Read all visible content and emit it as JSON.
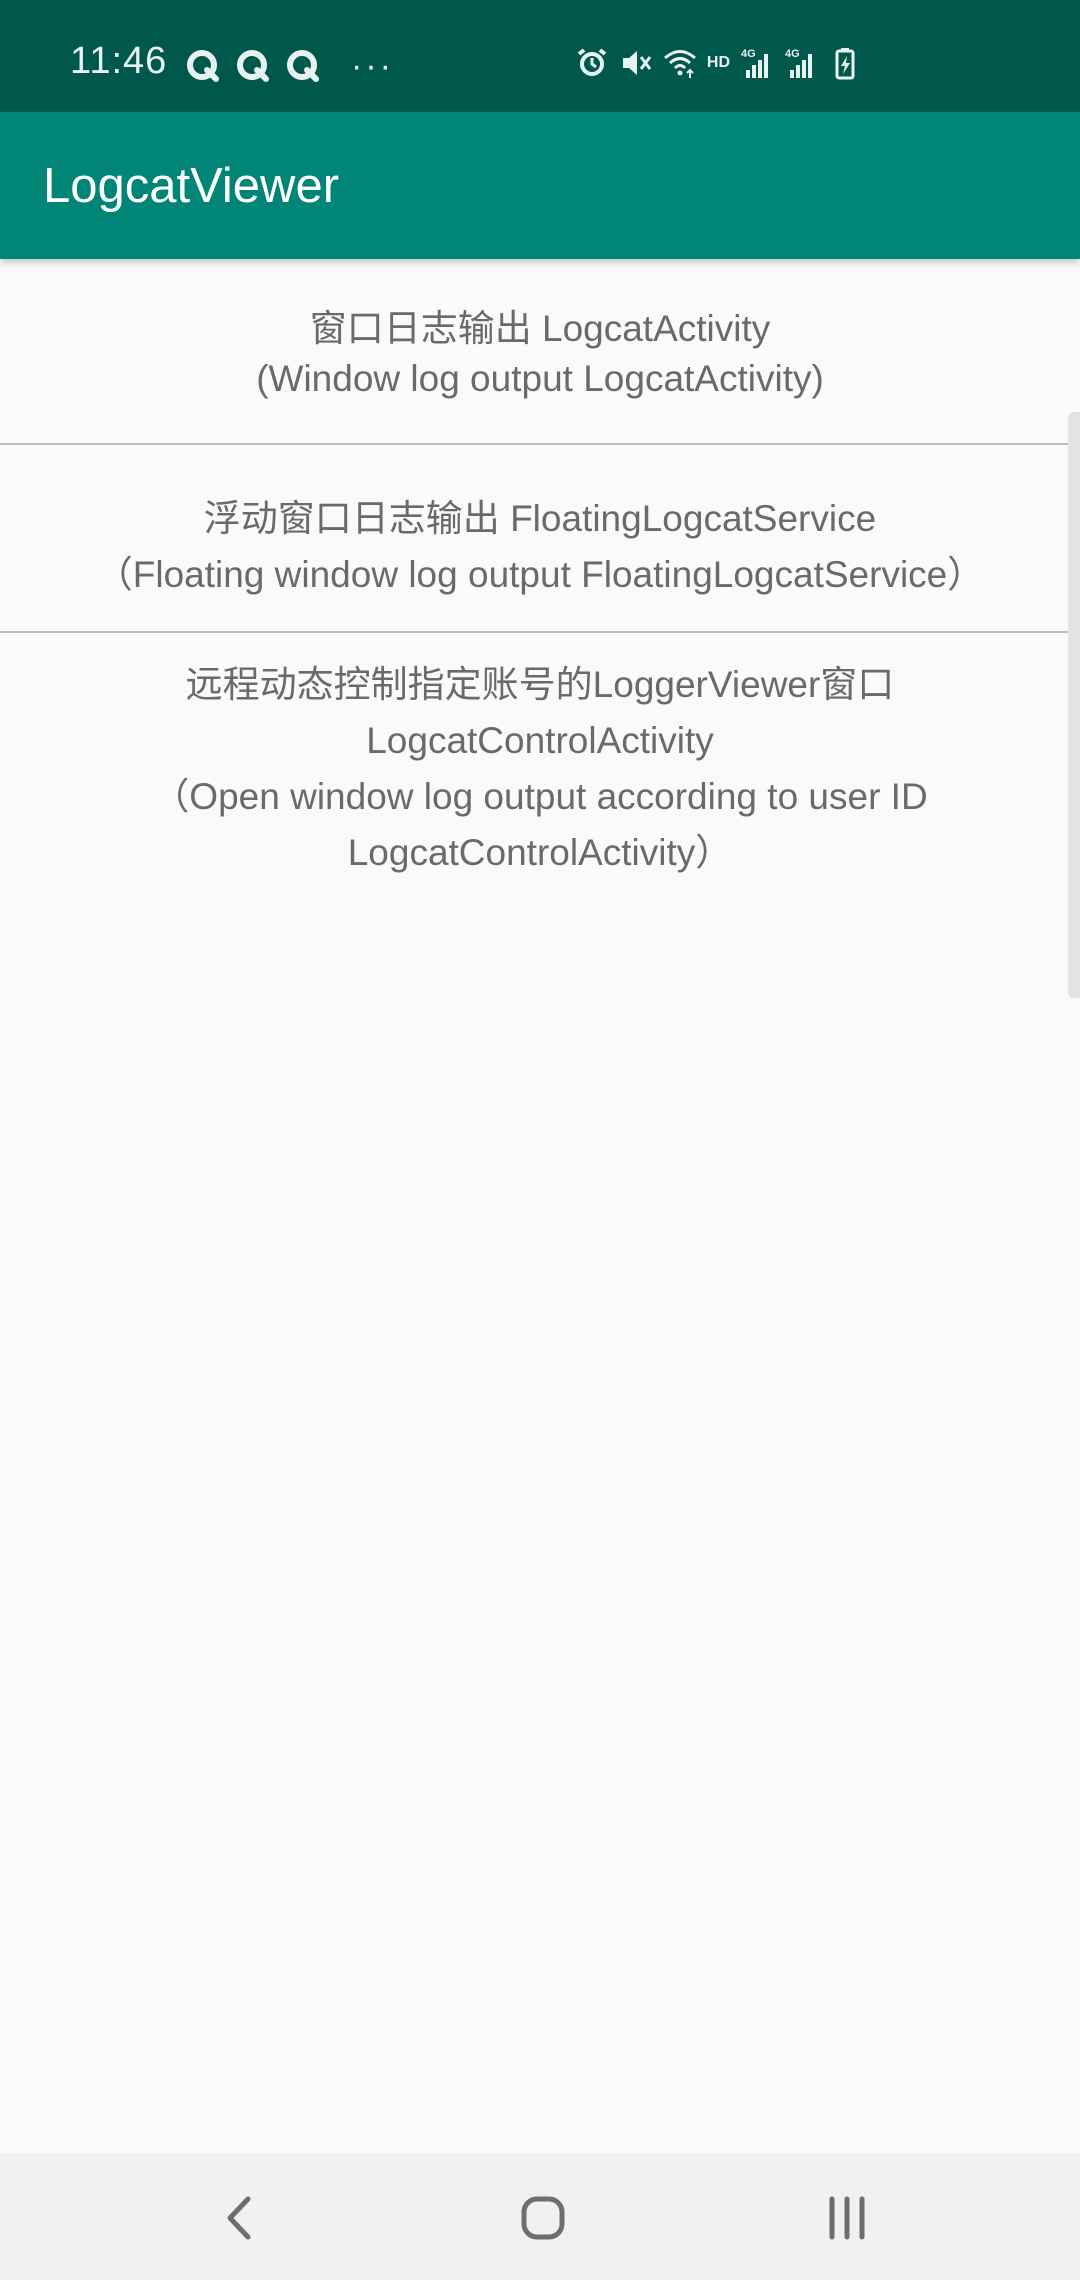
{
  "status_bar": {
    "time": "11:46",
    "left_icons": [
      "q-notification-icon",
      "q-notification-icon",
      "q-notification-icon"
    ],
    "overflow": "···",
    "right_icons": [
      "alarm-icon",
      "mute-icon",
      "wifi-icon",
      "hd-label",
      "signal-4g-icon",
      "signal-4g-icon",
      "battery-charging-icon"
    ],
    "hd_label": "HD"
  },
  "app_bar": {
    "title": "LogcatViewer"
  },
  "list": {
    "items": [
      {
        "line1": "窗口日志输出 LogcatActivity",
        "line2": "(Window log output LogcatActivity)"
      },
      {
        "line1": "浮动窗口日志输出 FloatingLogcatService",
        "line2": "（Floating window log output FloatingLogcatService）"
      },
      {
        "line1": "远程动态控制指定账号的LoggerViewer窗口",
        "line2": "LogcatControlActivity",
        "line3": "（Open window log output according to user ID",
        "line4": "LogcatControlActivity）"
      }
    ]
  },
  "nav_bar": {
    "buttons": [
      "back-icon",
      "home-icon",
      "recents-icon"
    ]
  },
  "colors": {
    "status_bar": "#00574b",
    "app_bar": "#008577",
    "background": "#fafafa",
    "text": "#6a6a6a",
    "divider": "#bdbdbd"
  }
}
